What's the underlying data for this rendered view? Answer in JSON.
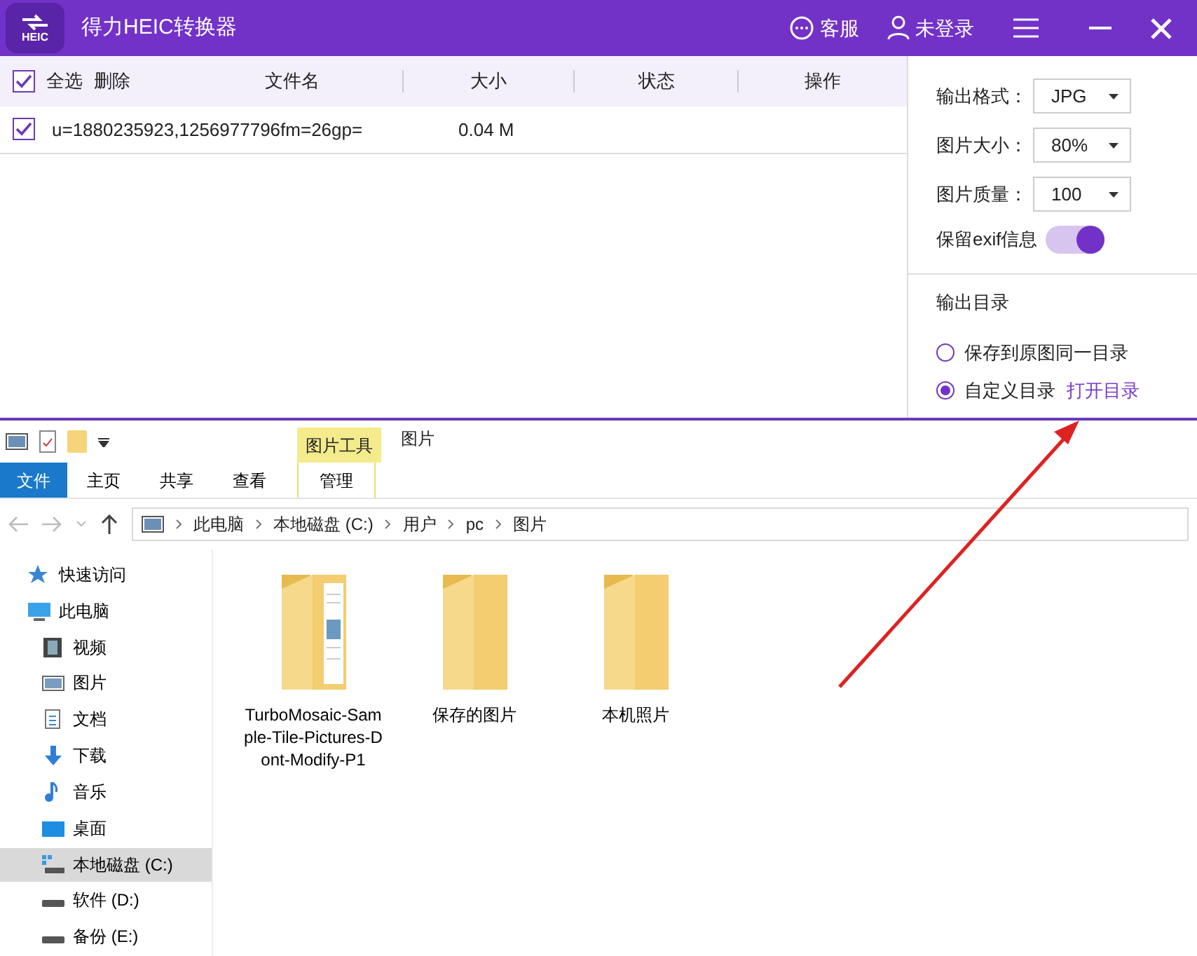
{
  "app": {
    "title": "得力HEIC转换器",
    "logo_label": "HEIC",
    "service": "客服",
    "login": "未登录"
  },
  "file_table": {
    "select_all": {
      "label": "全选",
      "checked": true
    },
    "delete": "删除",
    "columns": [
      "文件名",
      "大小",
      "状态",
      "操作"
    ],
    "rows": [
      {
        "checked": true,
        "name": "u=1880235923,1256977796fm=26gp=",
        "size": "0.04 M"
      }
    ]
  },
  "settings": {
    "fields": [
      {
        "label": "输出格式：",
        "value": "JPG"
      },
      {
        "label": "图片大小：",
        "value": "80%"
      },
      {
        "label": "图片质量：",
        "value": "100"
      }
    ],
    "exif": {
      "label": "保留exif信息",
      "on": true
    },
    "output_dir": {
      "title": "输出目录",
      "options": [
        {
          "label": "保存到原图同一目录",
          "selected": false
        },
        {
          "label": "自定义目录",
          "selected": true
        }
      ],
      "open_link": "打开目录"
    }
  },
  "explorer": {
    "context_tab": "图片工具",
    "title": "图片",
    "ribbon_tabs": [
      {
        "label": "文件",
        "kind": "file",
        "selected": false
      },
      {
        "label": "主页",
        "kind": "tab",
        "selected": false
      },
      {
        "label": "共享",
        "kind": "tab",
        "selected": false
      },
      {
        "label": "查看",
        "kind": "tab",
        "selected": false
      },
      {
        "label": "管理",
        "kind": "context",
        "selected": false
      }
    ],
    "breadcrumb": [
      "此电脑",
      "本地磁盘 (C:)",
      "用户",
      "pc",
      "图片"
    ],
    "nav": [
      {
        "label": "快速访问",
        "kind": "star",
        "selected": false
      },
      {
        "label": "此电脑",
        "kind": "pc",
        "selected": false,
        "children": [
          {
            "label": "视频",
            "kind": "video",
            "selected": false
          },
          {
            "label": "图片",
            "kind": "pictures",
            "selected": false
          },
          {
            "label": "文档",
            "kind": "docs",
            "selected": false
          },
          {
            "label": "下载",
            "kind": "download",
            "selected": false
          },
          {
            "label": "音乐",
            "kind": "music",
            "selected": false
          },
          {
            "label": "桌面",
            "kind": "desktop",
            "selected": false
          },
          {
            "label": "本地磁盘 (C:)",
            "kind": "sysdrive",
            "selected": true
          },
          {
            "label": "软件 (D:)",
            "kind": "drive",
            "selected": false
          },
          {
            "label": "备份 (E:)",
            "kind": "drive",
            "selected": false
          }
        ]
      }
    ],
    "items": [
      {
        "name": "TurboMosaic-Sample-Tile-Pictures-Dont-Modify-P1",
        "kind": "preview"
      },
      {
        "name": "保存的图片",
        "kind": "plain"
      },
      {
        "name": "本机照片",
        "kind": "plain"
      }
    ]
  }
}
